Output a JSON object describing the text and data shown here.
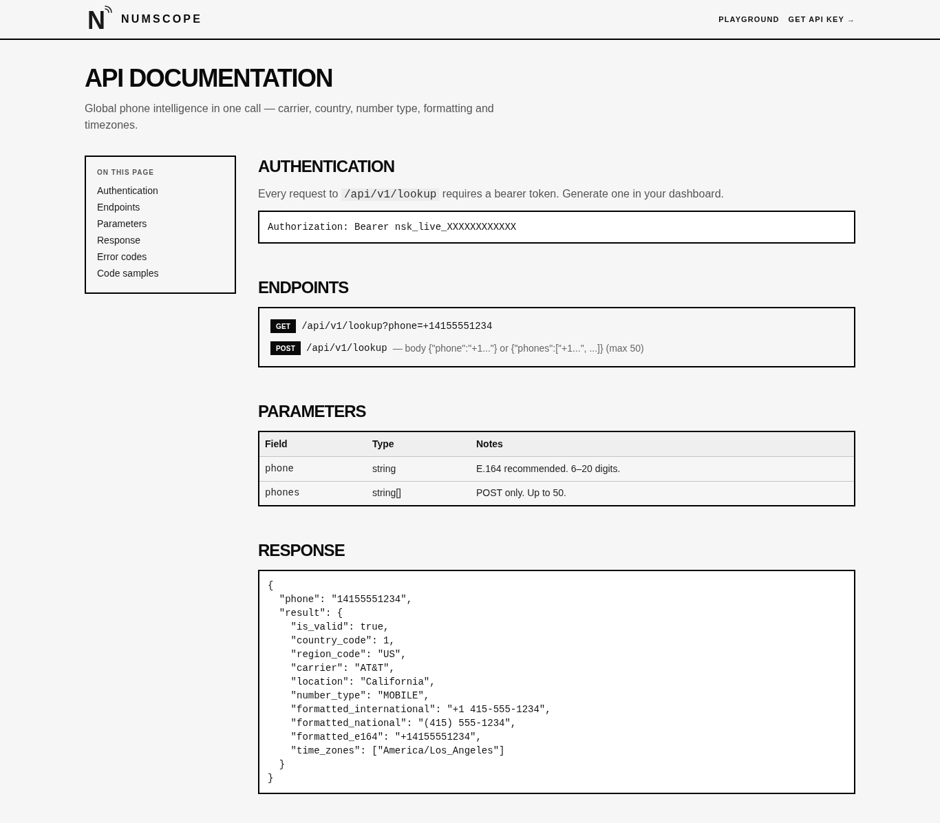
{
  "header": {
    "logo": {
      "mark": "N",
      "name": "NUMSCOPE"
    },
    "nav": [
      {
        "label": "PLAYGROUND"
      },
      {
        "label": "GET API KEY →"
      }
    ]
  },
  "page": {
    "title": "API DOCUMENTATION",
    "subtitle": "Global phone intelligence in one call — carrier, country, number type, formatting and timezones."
  },
  "toc": {
    "heading": "ON THIS PAGE",
    "items": [
      {
        "label": "Authentication"
      },
      {
        "label": "Endpoints"
      },
      {
        "label": "Parameters"
      },
      {
        "label": "Response"
      },
      {
        "label": "Error codes"
      },
      {
        "label": "Code samples"
      }
    ]
  },
  "sections": [
    {
      "kind": "auth",
      "heading": "AUTHENTICATION",
      "intro": {
        "before": "Every request to",
        "code": "/api/v1/lookup",
        "after": "requires a bearer token. Generate one in your dashboard."
      },
      "code": "Authorization: Bearer nsk_live_XXXXXXXXXXXX"
    },
    {
      "kind": "endpoints",
      "heading": "ENDPOINTS",
      "endpoints": [
        {
          "method": "GET",
          "path": "/api/v1/lookup?phone=+14155551234"
        },
        {
          "method": "POST",
          "path": "/api/v1/lookup",
          "note": "— body {\"phone\":\"+1...\"} or {\"phones\":[\"+1...\", ...]} (max 50)"
        }
      ]
    },
    {
      "kind": "table",
      "heading": "PARAMETERS",
      "columns": [
        "Field",
        "Type",
        "Notes"
      ],
      "rows": [
        [
          "phone",
          "string",
          "E.164 recommended. 6–20 digits."
        ],
        [
          "phones",
          "string[]",
          "POST only. Up to 50."
        ]
      ]
    },
    {
      "kind": "code",
      "heading": "RESPONSE",
      "lines": [
        "{",
        "  \"phone\": \"14155551234\",",
        "  \"result\": {",
        "    \"is_valid\": true,",
        "    \"country_code\": 1,",
        "    \"region_code\": \"US\",",
        "    \"carrier\": \"AT&T\",",
        "    \"location\": \"California\",",
        "    \"number_type\": \"MOBILE\",",
        "    \"formatted_international\": \"+1 415-555-1234\",",
        "    \"formatted_national\": \"(415) 555-1234\",",
        "    \"formatted_e164\": \"+14155551234\",",
        "    \"time_zones\": [\"America/Los_Angeles\"]",
        "  }",
        "}"
      ]
    }
  ]
}
